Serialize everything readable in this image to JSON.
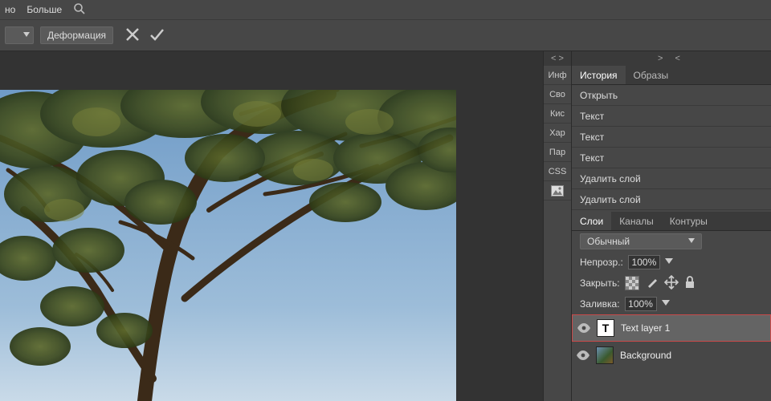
{
  "menubar": {
    "item0": "но",
    "item1": "Больше"
  },
  "toolbar": {
    "warp_label": "Деформация"
  },
  "sideTabs": {
    "arrows": "< >",
    "items": [
      "Инф",
      "Сво",
      "Кис",
      "Хар",
      "Пар",
      "CSS"
    ]
  },
  "rightPanel": {
    "arrows": "> <",
    "historyTabs": {
      "tab0": "История",
      "tab1": "Образы"
    },
    "history": [
      "Открыть",
      "Текст",
      "Текст",
      "Текст",
      "Удалить слой",
      "Удалить слой"
    ],
    "layersTabs": {
      "tab0": "Слои",
      "tab1": "Каналы",
      "tab2": "Контуры"
    },
    "blendMode": "Обычный",
    "opacityLabel": "Непрозр.:",
    "opacityValue": "100%",
    "lockLabel": "Закрыть:",
    "fillLabel": "Заливка:",
    "fillValue": "100%",
    "layers": [
      {
        "name": "Text layer 1",
        "type": "T"
      },
      {
        "name": "Background",
        "type": "bg"
      }
    ]
  }
}
